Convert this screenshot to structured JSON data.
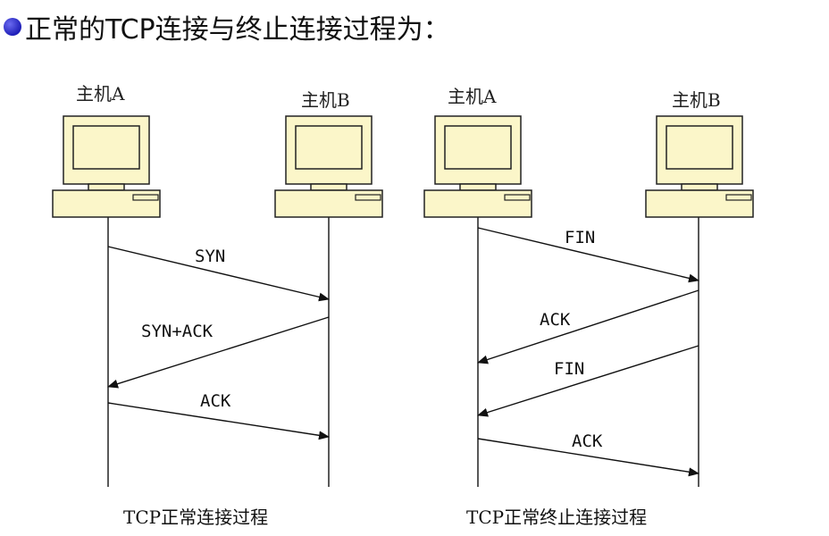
{
  "headline": "正常的TCP连接与终止连接过程为：",
  "diagrams": [
    {
      "caption": "TCP正常连接过程",
      "hosts": [
        "主机A",
        "主机B"
      ],
      "messages": [
        "SYN",
        "SYN+ACK",
        "ACK"
      ]
    },
    {
      "caption": "TCP正常终止连接过程",
      "hosts": [
        "主机A",
        "主机B"
      ],
      "messages": [
        "FIN",
        "ACK",
        "FIN",
        "ACK"
      ]
    }
  ],
  "colors": {
    "computer_fill": "#fbf6c9",
    "stroke": "#222222",
    "bullet": "#2b2bc4"
  }
}
